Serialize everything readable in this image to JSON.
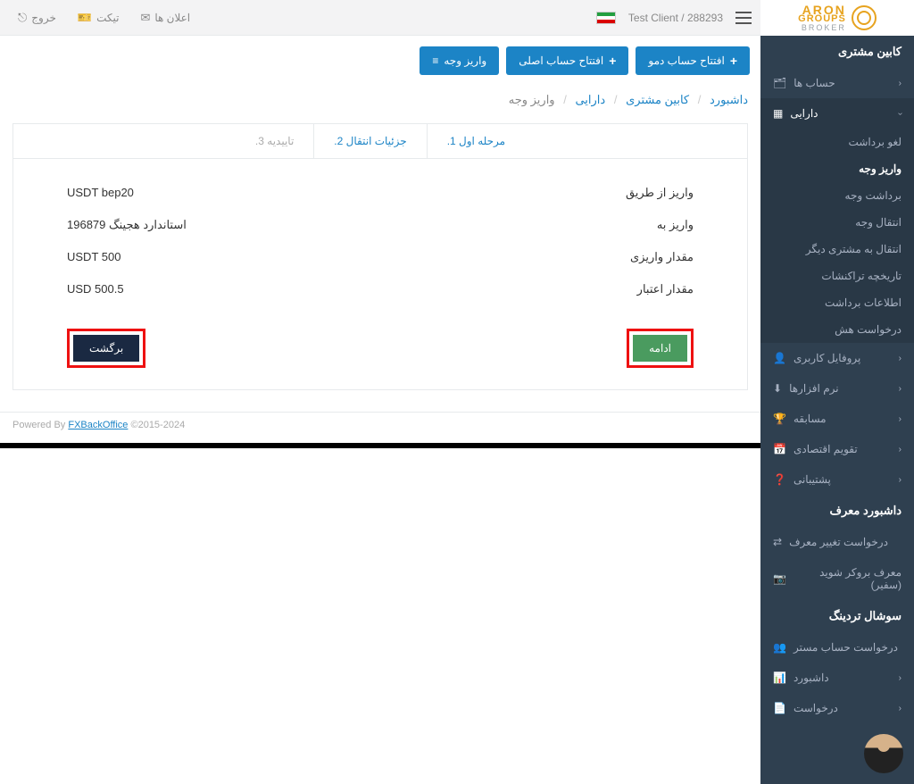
{
  "logo": {
    "line1": "ARON",
    "line2": "GROUPS",
    "line3": "BROKER"
  },
  "sidebar": {
    "section_client": "کابین مشتری",
    "accounts": "حساب ها",
    "assets": "دارایی",
    "subs": {
      "cancel_withdraw": "لغو برداشت",
      "deposit": "واریز وجه",
      "withdraw": "برداشت وجه",
      "transfer": "انتقال وجه",
      "transfer_other": "انتقال به مشتری دیگر",
      "tx_history": "تاریخچه تراکنشات",
      "withdraw_info": "اطلاعات برداشت",
      "hash_request": "درخواست هش"
    },
    "profile": "پروفایل کاربری",
    "apps": "نرم افزارها",
    "contest": "مسابقه",
    "calendar": "تقویم اقتصادی",
    "support": "پشتیبانی",
    "section_ib": "داشبورد معرف",
    "ib_change": "درخواست تغییر معرف",
    "ib_become": "معرف بروکر شوید (سفیر)",
    "section_social": "سوشال تردینگ",
    "master_req": "درخواست حساب مستر",
    "dashboard": "داشبورد",
    "request": "درخواست"
  },
  "topbar": {
    "client": "Test Client / 288293",
    "announcements": "اعلان ها",
    "ticket": "تیکت",
    "logout": "خروج"
  },
  "btns": {
    "demo": "افتتاح حساب دمو",
    "real": "افتتاح حساب اصلی",
    "deposit": "واریز وجه"
  },
  "breadcrumb": {
    "dashboard": "داشبورد",
    "cabinet": "کابین مشتری",
    "assets": "دارایی",
    "deposit": "واریز وجه"
  },
  "tabs": {
    "step1": "مرحله اول",
    "step1_num": ".1",
    "step2": "جزئیات انتقال",
    "step2_num": ".2",
    "step3": "تاییدیه",
    "step3_num": ".3"
  },
  "kv": {
    "method_label": "واریز از طریق",
    "method_value": "USDT bep20",
    "to_label": "واریز به",
    "to_value": "استاندارد هجینگ 196879",
    "amount_label": "مقدار واریزی",
    "amount_value": "USDT 500",
    "credit_label": "مقدار اعتبار",
    "credit_value": "USD 500.5"
  },
  "actions": {
    "continue": "ادامه",
    "back": "برگشت"
  },
  "footer": {
    "powered": "Powered By ",
    "brand": "FXBackOffice",
    "years": " ©2015-2024"
  }
}
